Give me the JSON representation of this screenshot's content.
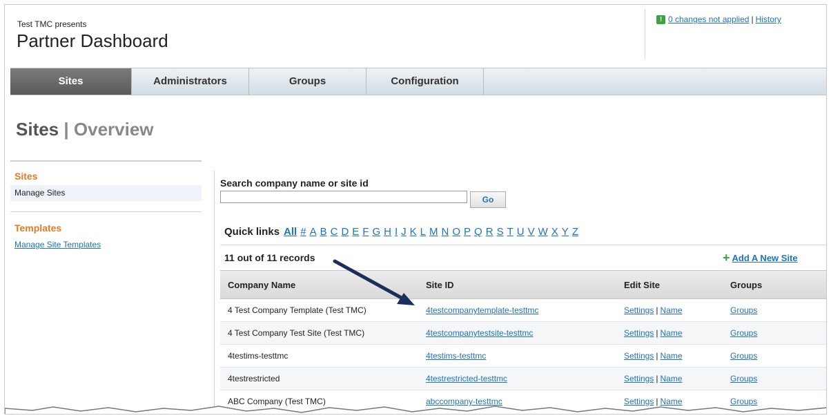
{
  "header": {
    "presents": "Test TMC presents",
    "title": "Partner Dashboard",
    "changes_link": "0 changes not applied",
    "separator": "|",
    "history_link": "History"
  },
  "tabs": [
    {
      "label": "Sites",
      "active": true
    },
    {
      "label": "Administrators",
      "active": false
    },
    {
      "label": "Groups",
      "active": false
    },
    {
      "label": "Configuration",
      "active": false
    }
  ],
  "page": {
    "title": "Sites",
    "separator": "|",
    "subtitle": "Overview"
  },
  "sidebar": {
    "sections": [
      {
        "heading": "Sites",
        "items": [
          {
            "label": "Manage Sites",
            "active": true
          }
        ]
      },
      {
        "heading": "Templates",
        "items": [
          {
            "label": "Manage Site Templates",
            "active": false
          }
        ]
      }
    ]
  },
  "search": {
    "label": "Search company name or site id",
    "value": "",
    "button": "Go"
  },
  "quick_links": {
    "label": "Quick links",
    "links": [
      "All",
      "#",
      "A",
      "B",
      "C",
      "D",
      "E",
      "F",
      "G",
      "H",
      "I",
      "J",
      "K",
      "L",
      "M",
      "N",
      "O",
      "P",
      "Q",
      "R",
      "S",
      "T",
      "U",
      "V",
      "W",
      "X",
      "Y",
      "Z"
    ]
  },
  "records": {
    "summary": "11 out of 11 records",
    "add_label": "Add A New Site"
  },
  "table": {
    "columns": [
      "Company Name",
      "Site ID",
      "Edit Site",
      "Groups"
    ],
    "rows": [
      {
        "company": "4 Test Company Template (Test TMC)",
        "site_id": "4testcompanytemplate-testtmc",
        "settings": "Settings",
        "name": "Name",
        "groups": "Groups"
      },
      {
        "company": "4 Test Company Test Site (Test TMC)",
        "site_id": "4testcompanytestsite-testtmc",
        "settings": "Settings",
        "name": "Name",
        "groups": "Groups"
      },
      {
        "company": "4testims-testtmc",
        "site_id": "4testims-testtmc",
        "settings": "Settings",
        "name": "Name",
        "groups": "Groups"
      },
      {
        "company": "4testrestricted",
        "site_id": "4testrestricted-testtmc",
        "settings": "Settings",
        "name": "Name",
        "groups": "Groups"
      },
      {
        "company": "ABC Company (Test TMC)",
        "site_id": "abccompany-testtmc",
        "settings": "Settings",
        "name": "Name",
        "groups": "Groups"
      }
    ]
  },
  "colors": {
    "accent": "#e37a23",
    "link": "#1f72bd",
    "active_tab": "#5a5a5a",
    "success": "#3ea33e",
    "arrow": "#1b2f5e"
  }
}
